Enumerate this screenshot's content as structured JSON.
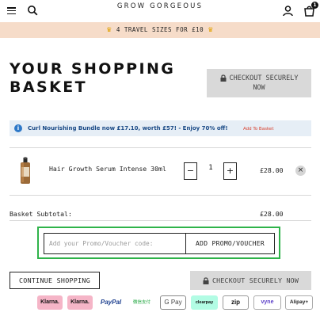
{
  "header": {
    "logo": "GROW GORGEOUS",
    "cart_count": "1",
    "menu_icon": "hamburger-menu-icon",
    "search_icon": "search-icon",
    "account_icon": "user-icon",
    "bag_icon": "shopping-bag-icon"
  },
  "promo_strip": {
    "text": "4 TRAVEL SIZES FOR £10",
    "icon": "crown-icon",
    "icon_color": "#e0a100",
    "background": "#f6dcc9"
  },
  "page": {
    "title_line1": "YOUR SHOPPING",
    "title_line2": "BASKET",
    "checkout_top_line1": "CHECKOUT SECURELY",
    "checkout_top_line2": "NOW"
  },
  "offer": {
    "text": "Curl Nourishing Bundle now £17.10, worth £57! - Enjoy 70% off!",
    "link": "Add To Basket",
    "icon": "info-icon",
    "link_color": "#d8412f",
    "background": "#e6eef6"
  },
  "basket": {
    "items": [
      {
        "name": "Hair Growth Serum Intense 30ml",
        "quantity": "1",
        "price": "£28.00",
        "minus": "−",
        "plus": "+",
        "remove": "×"
      }
    ],
    "subtotal_label": "Basket Subtotal:",
    "subtotal_value": "£28.00"
  },
  "promo_code": {
    "placeholder": "Add your Promo/Voucher code:",
    "value": "",
    "button": "ADD PROMO/VOUCHER",
    "highlight_color": "#2fb34a"
  },
  "actions": {
    "continue": "CONTINUE SHOPPING",
    "checkout_bottom": "CHECKOUT SECURELY NOW"
  },
  "payments": [
    "Klarna.",
    "Klarna.",
    "PayPal",
    "微信支付",
    "G Pay",
    "clearpay",
    "zip",
    "vyne",
    "Alipay+"
  ]
}
